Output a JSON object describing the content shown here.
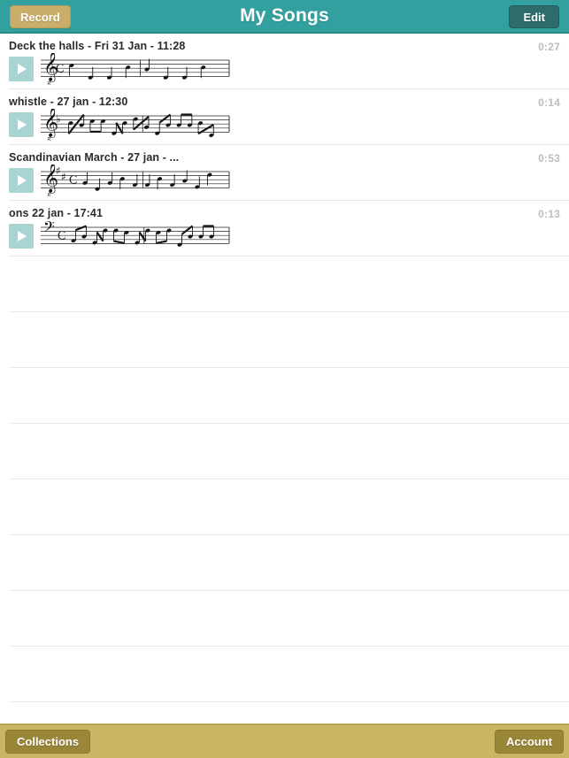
{
  "header": {
    "title": "My Songs",
    "record_label": "Record",
    "edit_label": "Edit",
    "background_color": "#33a0a0",
    "record_color": "#c9ad68",
    "edit_color": "#2e6b6b"
  },
  "songs": [
    {
      "title": "Deck the halls - Fri 31 Jan - 11:28",
      "duration": "0:27",
      "clef": "treble-8",
      "time_signature": "common",
      "accidentals": 0,
      "accidental_type": "sharp"
    },
    {
      "title": "whistle - 27 jan - 12:30",
      "duration": "0:14",
      "clef": "treble-8",
      "time_signature": "none",
      "accidentals": 1,
      "accidental_type": "flat"
    },
    {
      "title": "Scandinavian March - 27 jan - ...",
      "duration": "0:53",
      "clef": "treble-8",
      "time_signature": "common",
      "accidentals": 2,
      "accidental_type": "sharp"
    },
    {
      "title": "ons 22 jan - 17:41",
      "duration": "0:13",
      "clef": "bass",
      "time_signature": "common",
      "accidentals": 0,
      "accidental_type": "sharp"
    }
  ],
  "empty_row_count": 9,
  "play_icon": "play-triangle-icon",
  "list": {
    "background_color": "#ffffff",
    "separator_color": "#e6e6e6",
    "play_button_color": "#a8d4d4",
    "duration_color": "#bdbdbd"
  },
  "toolbar": {
    "collections_label": "Collections",
    "account_label": "Account",
    "background_color": "#c9b563",
    "button_color": "#9a8638"
  }
}
